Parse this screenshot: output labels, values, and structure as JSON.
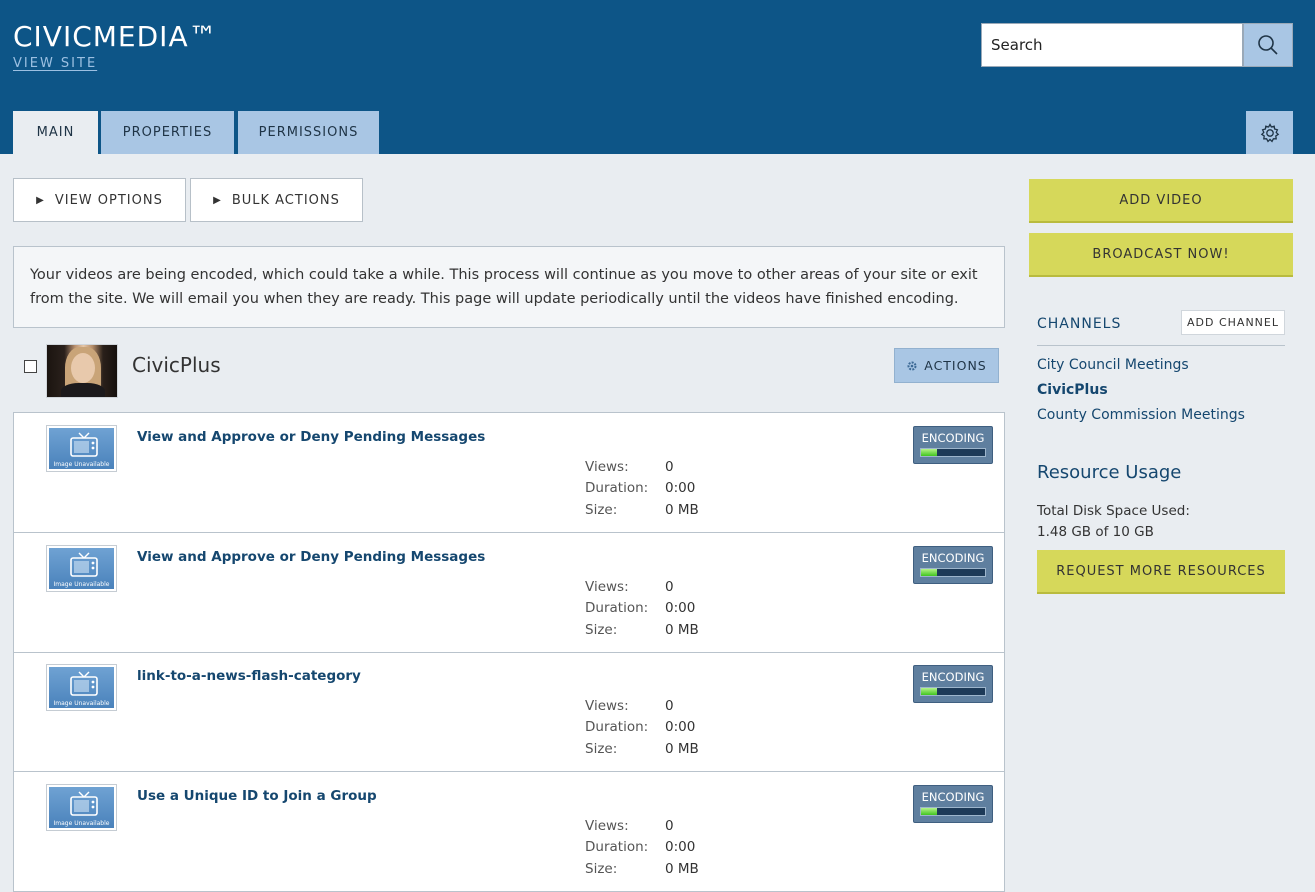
{
  "header": {
    "app_title": "CIVICMEDIA™",
    "view_site": "VIEW SITE",
    "search_placeholder": "Search"
  },
  "tabs": [
    {
      "label": "MAIN",
      "active": true
    },
    {
      "label": "PROPERTIES",
      "active": false
    },
    {
      "label": "PERMISSIONS",
      "active": false
    }
  ],
  "toolbar": {
    "view_options": "VIEW OPTIONS",
    "bulk_actions": "BULK ACTIONS"
  },
  "notice": "Your videos are being encoded, which could take a while. This process will continue as you move to other areas of your site or exit from the site. We will email you when they are ready. This page will update periodically until the videos have finished encoding.",
  "channel": {
    "title": "CivicPlus",
    "actions_label": "ACTIONS"
  },
  "video_meta_labels": {
    "views": "Views:",
    "duration": "Duration:",
    "size": "Size:"
  },
  "thumb_label": "Image Unavailable",
  "videos": [
    {
      "title": "View and Approve or Deny Pending Messages",
      "views": "0",
      "duration": "0:00",
      "size": "0 MB",
      "status": "ENCODING",
      "progress": 0.25
    },
    {
      "title": "View and Approve or Deny Pending Messages",
      "views": "0",
      "duration": "0:00",
      "size": "0 MB",
      "status": "ENCODING",
      "progress": 0.25
    },
    {
      "title": "link-to-a-news-flash-category",
      "views": "0",
      "duration": "0:00",
      "size": "0 MB",
      "status": "ENCODING",
      "progress": 0.25
    },
    {
      "title": "Use a Unique ID to Join a Group",
      "views": "0",
      "duration": "0:00",
      "size": "0 MB",
      "status": "ENCODING",
      "progress": 0.25
    }
  ],
  "sidebar": {
    "add_video": "ADD VIDEO",
    "broadcast_now": "BROADCAST NOW!",
    "channels_heading": "CHANNELS",
    "add_channel": "ADD CHANNEL",
    "channels": [
      {
        "label": "City Council Meetings",
        "current": false
      },
      {
        "label": "CivicPlus",
        "current": true
      },
      {
        "label": "County Commission Meetings",
        "current": false
      }
    ],
    "resource_heading": "Resource Usage",
    "disk_label": "Total Disk Space Used:",
    "disk_value": "1.48 GB of 10 GB",
    "request_more": "REQUEST MORE RESOURCES"
  },
  "colors": {
    "header_bg": "#0d5587",
    "tab_bg": "#a9c6e4",
    "accent_yellow": "#d6d85a",
    "link_blue": "#15476f",
    "encoding_fill": "#41c520"
  },
  "icons": {
    "search": "search-icon",
    "gear": "gear-icon",
    "actions": "gear-icon",
    "thumbnail": "tv-icon",
    "toolbar": "triangle-right-icon"
  }
}
